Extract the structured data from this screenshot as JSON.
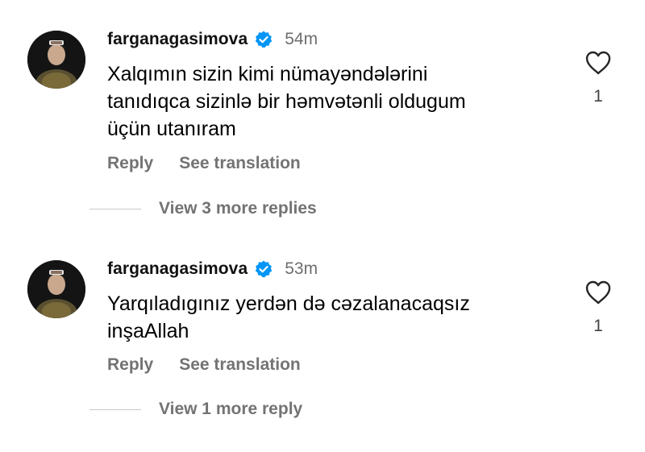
{
  "comments": [
    {
      "username": "farganagasimova",
      "time": "54m",
      "text": "Xalqımın sizin kimi nümayəndələrini\ntanıdıqca sizinlə bir həmvətənli oldugum\nüçün utanıram",
      "reply_label": "Reply",
      "translate_label": "See translation",
      "like_count": "1",
      "more_replies_label": "View 3 more replies",
      "verified_icon": "verified-badge-icon",
      "like_icon": "heart-outline-icon"
    },
    {
      "username": "farganagasimova",
      "time": "53m",
      "text": "Yarqıladıgınız yerdən də cəzalanacaqsız\ninşaAllah",
      "reply_label": "Reply",
      "translate_label": "See translation",
      "like_count": "1",
      "more_replies_label": "View 1 more reply",
      "verified_icon": "verified-badge-icon",
      "like_icon": "heart-outline-icon"
    }
  ],
  "colors": {
    "verified_blue": "#0095f6",
    "secondary_text": "#737373",
    "timestamp": "#6e6e6e"
  }
}
